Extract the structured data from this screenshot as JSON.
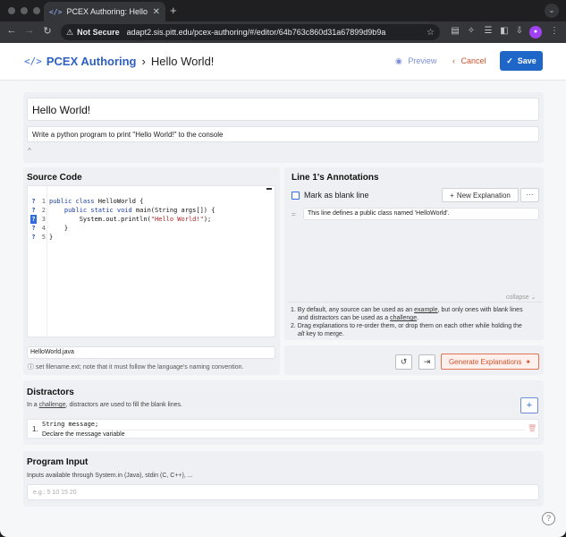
{
  "browser": {
    "tab_title": "PCEX Authoring: Hello World!",
    "tab_icon": "code-icon",
    "security_label": "Not Secure",
    "url": "adapt2.sis.pitt.edu/pcex-authoring/#/editor/64b763c860d31a67899d9b9a",
    "profile_initial": "●"
  },
  "header": {
    "brand": "PCEX Authoring",
    "breadcrumb": "Hello World!",
    "preview_label": "Preview",
    "cancel_label": "Cancel",
    "save_label": "Save"
  },
  "activity": {
    "title": "Hello World!",
    "description": "Write a python program to print \"Hello World!\" to the console"
  },
  "source_code": {
    "heading": "Source Code",
    "filename": "HelloWorld.java",
    "filename_hint": "set filename.ext; note that it must follow the language's naming convention."
  },
  "annotations": {
    "heading": "Line 1's Annotations",
    "blank_label": "Mark as blank line",
    "new_explanation_label": "New Explanation",
    "more_label": "···",
    "explanation": "This line defines a public class named 'HelloWorld'.",
    "collapse_label": "collapse",
    "note_1_a": "1. By default, any source can be used as an ",
    "note_1_link": "example",
    "note_1_b": ", but only ones with blank lines",
    "note_1_c": "and distractors can be used as a ",
    "note_1_link2": "challenge",
    "note_2_a": "2. Drag explanations to re-order them, or drop them on each other while holding the",
    "note_2_key": "alt",
    "note_2_b": " key to merge.",
    "generate_label": "Generate Explanations"
  },
  "distractors": {
    "heading": "Distractors",
    "hint_a": "In a ",
    "hint_link": "challenge",
    "hint_b": ", distractors are used to fill the blank lines.",
    "items": [
      {
        "number": "1.",
        "code": "String message;",
        "explanation": "Declare the message variable"
      }
    ]
  },
  "program_input": {
    "heading": "Program Input",
    "hint": "Inputs available through System.in (Java), stdin (C, C++), ...",
    "placeholder": "e.g.: 5 10 15 20"
  },
  "colors": {
    "brand": "#2e5fc2",
    "save": "#1f66c9",
    "cancel": "#d0532c",
    "generate": "#d0532c"
  }
}
